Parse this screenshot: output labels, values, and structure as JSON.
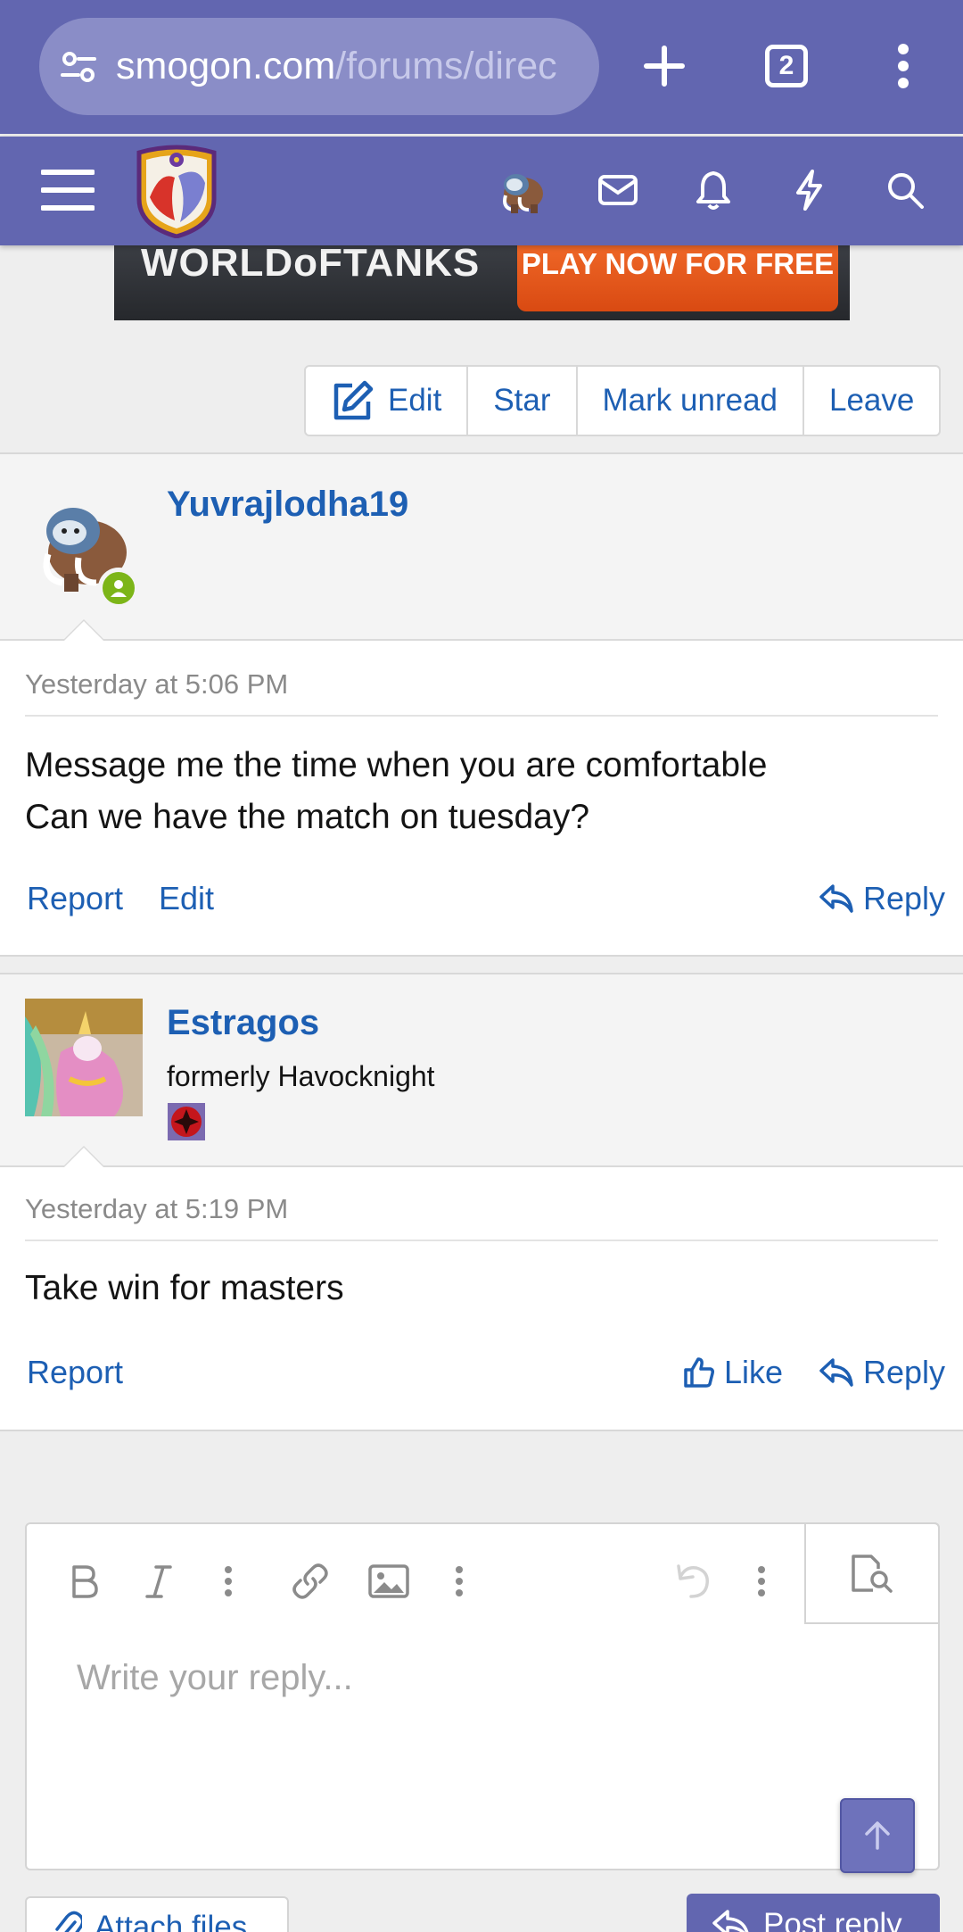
{
  "browser": {
    "url_domain": "smogon.com",
    "url_path": "/forums/direc",
    "tab_count": "2"
  },
  "header": {
    "menu_icon": "hamburger-icon",
    "icons": [
      "avatar",
      "envelope-icon",
      "bell-icon",
      "bolt-icon",
      "search-icon"
    ]
  },
  "ad": {
    "brand": "WORLDoFTANKS",
    "cta": "PLAY NOW FOR FREE"
  },
  "conversation_actions": {
    "edit": "Edit",
    "star": "Star",
    "mark_unread": "Mark unread",
    "leave": "Leave"
  },
  "messages": [
    {
      "username": "Yuvrajlodha19",
      "date": "Yesterday at 5:06 PM",
      "body_lines": [
        "Message me the time when you are comfortable",
        "Can we have the match on tuesday?"
      ],
      "actions": {
        "report": "Report",
        "edit": "Edit",
        "reply": "Reply"
      }
    },
    {
      "username": "Estragos",
      "user_title": "formerly Havocknight",
      "date": "Yesterday at 5:19 PM",
      "body_lines": [
        "Take win for masters"
      ],
      "actions": {
        "report": "Report",
        "like": "Like",
        "reply": "Reply"
      }
    }
  ],
  "editor": {
    "placeholder": "Write your reply...",
    "attach_label": "Attach files",
    "post_label": "Post reply"
  },
  "colors": {
    "brand": "#6266b0",
    "link": "#1d5fb3",
    "online": "#7cb518"
  }
}
